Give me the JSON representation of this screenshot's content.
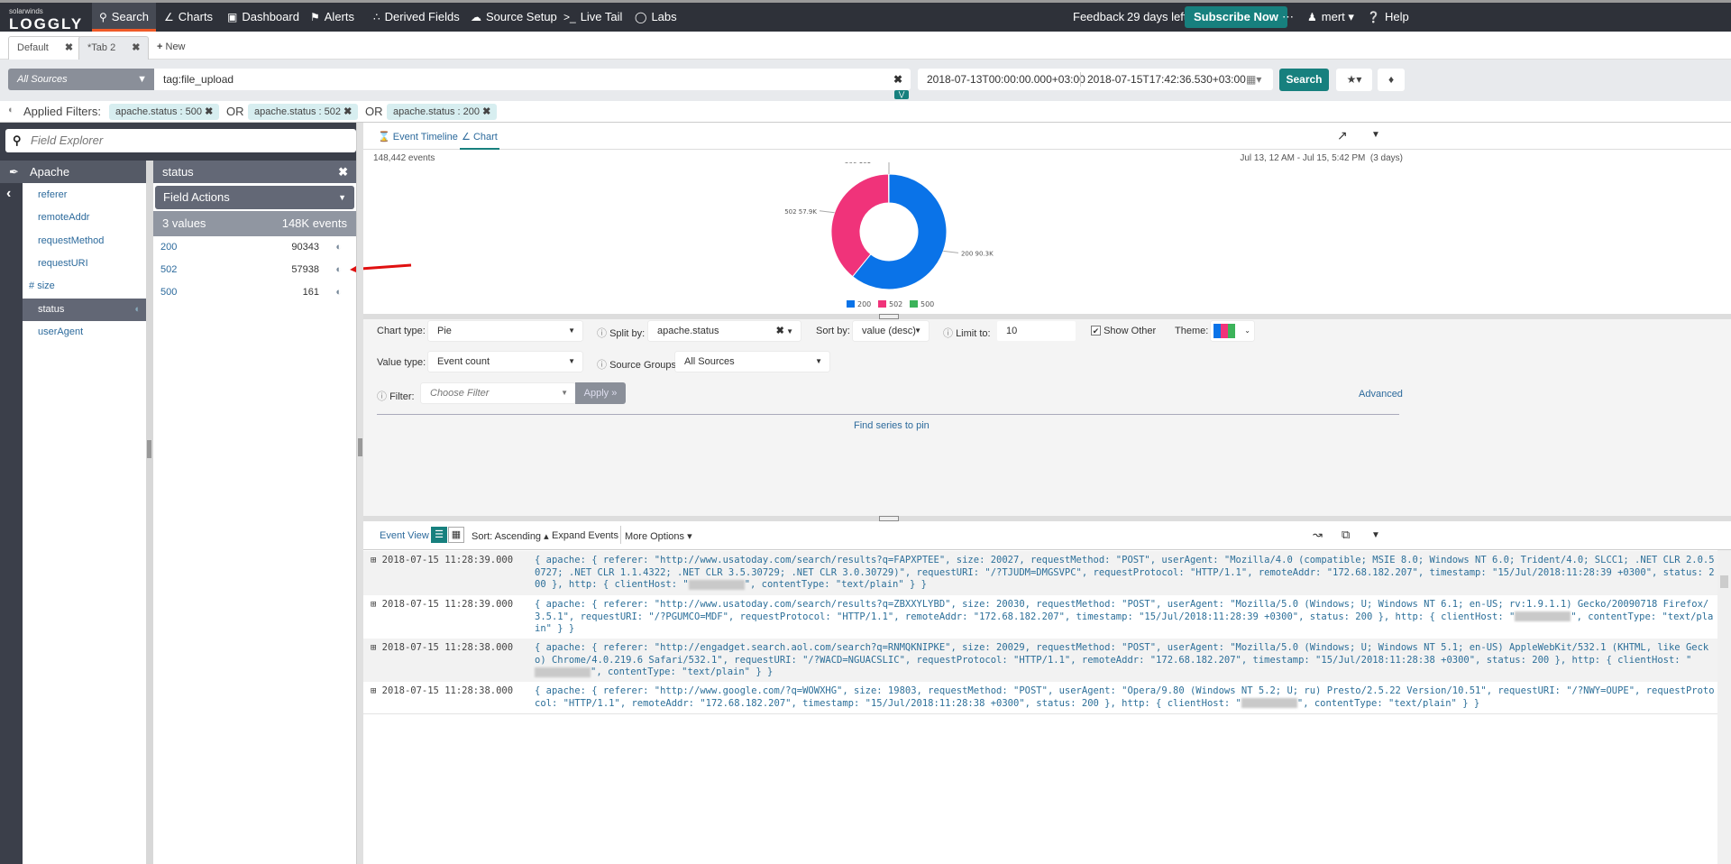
{
  "brand": {
    "company": "solarwinds",
    "product": "LOGGLY",
    "accent": "#f05a28",
    "teal": "#17807e"
  },
  "nav": {
    "items": [
      {
        "label": "Search",
        "icon": "search-icon"
      },
      {
        "label": "Charts",
        "icon": "chart-icon"
      },
      {
        "label": "Dashboard",
        "icon": "dashboard-icon"
      },
      {
        "label": "Alerts",
        "icon": "bell-icon"
      },
      {
        "label": "Derived Fields",
        "icon": "derived-fields-icon"
      },
      {
        "label": "Source Setup",
        "icon": "cloud-icon"
      },
      {
        "label": "Live Tail",
        "icon": "terminal-icon"
      },
      {
        "label": "Labs",
        "icon": "lightbulb-icon"
      }
    ],
    "feedback": "Feedback",
    "trial": "29 days left",
    "subscribe": "Subscribe Now",
    "user": "mert",
    "help": "Help"
  },
  "tabs": [
    {
      "label": "Default"
    },
    {
      "label": "*Tab 2"
    }
  ],
  "new_tab": "New",
  "search": {
    "source": "All Sources",
    "query": "tag:file_upload",
    "from": "2018-07-13T00:00:00.000+03:00",
    "to": "2018-07-15T17:42:36.530+03:00",
    "button": "Search"
  },
  "filters": {
    "label": "Applied Filters:",
    "or": "OR",
    "chips": [
      "apache.status : 500",
      "apache.status : 502",
      "apache.status : 200"
    ]
  },
  "field_explorer": {
    "placeholder": "Field Explorer",
    "group": "Apache",
    "fields": [
      "referer",
      "remoteAddr",
      "requestMethod",
      "requestURI",
      "size",
      "status",
      "userAgent"
    ],
    "size_prefix": "#",
    "field_title": "status",
    "field_actions": "Field Actions",
    "values_count": "3 values",
    "events_count": "148K events",
    "values": [
      {
        "value": "200",
        "count": "90343"
      },
      {
        "value": "502",
        "count": "57938"
      },
      {
        "value": "500",
        "count": "161"
      }
    ]
  },
  "view_tabs": {
    "timeline": "Event Timeline",
    "chart": "Chart"
  },
  "chart_info": {
    "events": "148,442 events",
    "range": "Jul 13, 12 AM - Jul 15, 5:42 PM  (3 days)"
  },
  "chart_data": {
    "type": "pie",
    "donut": true,
    "categories": [
      "200",
      "502",
      "500"
    ],
    "values": [
      90343,
      57938,
      161
    ],
    "labels": [
      "200 90.3K",
      "502 57.9K",
      "500 161"
    ],
    "colors": [
      "#0a73e8",
      "#f0337a",
      "#3cb35a"
    ],
    "legend": "bottom"
  },
  "options": {
    "chart_type_label": "Chart type:",
    "chart_type": "Pie",
    "split_label": "Split by:",
    "split": "apache.status",
    "sort_label": "Sort by:",
    "sort": "value (desc)",
    "limit_label": "Limit to:",
    "limit": "10",
    "show_other": "Show Other",
    "theme_label": "Theme:",
    "value_type_label": "Value type:",
    "value_type": "Event count",
    "source_groups_label": "Source Groups",
    "source_groups": "All Sources",
    "filter_label": "Filter:",
    "filter_placeholder": "Choose Filter",
    "apply": "Apply »",
    "advanced": "Advanced",
    "find_series": "Find series to pin"
  },
  "events_toolbar": {
    "event_view": "Event View",
    "sort": "Sort: Ascending",
    "expand": "Expand Events",
    "more": "More Options"
  },
  "events": [
    {
      "ts": "2018-07-15 11:28:39.000",
      "pre": "{ apache: { referer: \"http://www.usatoday.com/search/results?q=FAPXPTEE\", size: 20027, requestMethod: \"POST\", userAgent: \"Mozilla/4.0 (compatible; MSIE 8.0; Windows NT 6.0; Trident/4.0; SLCC1; .NET CLR 2.0.50727; .NET CLR 1.1.4322; .NET CLR 3.5.30729; .NET CLR 3.0.30729)\", requestURI: \"/?TJUDM=DMGSVPC\", requestProtocol: \"HTTP/1.1\", remoteAddr: \"172.68.182.207\", timestamp: \"15/Jul/2018:11:28:39 +0300\", status: 200 }, http: { clientHost: \"",
      "post": "\", contentType: \"text/plain\" } }"
    },
    {
      "ts": "2018-07-15 11:28:39.000",
      "pre": "{ apache: { referer: \"http://www.usatoday.com/search/results?q=ZBXXYLYBD\", size: 20030, requestMethod: \"POST\", userAgent: \"Mozilla/5.0 (Windows; U; Windows NT 6.1; en-US; rv:1.9.1.1) Gecko/20090718 Firefox/3.5.1\", requestURI: \"/?PGUMCO=MDF\", requestProtocol: \"HTTP/1.1\", remoteAddr: \"172.68.182.207\", timestamp: \"15/Jul/2018:11:28:39 +0300\", status: 200 }, http: { clientHost: \"",
      "post": "\", contentType: \"text/plain\" } }"
    },
    {
      "ts": "2018-07-15 11:28:38.000",
      "pre": "{ apache: { referer: \"http://engadget.search.aol.com/search?q=RNMQKNIPKE\", size: 20029, requestMethod: \"POST\", userAgent: \"Mozilla/5.0 (Windows; U; Windows NT 5.1; en-US) AppleWebKit/532.1 (KHTML, like Gecko) Chrome/4.0.219.6 Safari/532.1\", requestURI: \"/?WACD=NGUACSLIC\", requestProtocol: \"HTTP/1.1\", remoteAddr: \"172.68.182.207\", timestamp: \"15/Jul/2018:11:28:38 +0300\", status: 200 }, http: { clientHost: \"",
      "post": "\", contentType: \"text/plain\" } }"
    },
    {
      "ts": "2018-07-15 11:28:38.000",
      "pre": "{ apache: { referer: \"http://www.google.com/?q=WOWXHG\", size: 19803, requestMethod: \"POST\", userAgent: \"Opera/9.80 (Windows NT 5.2; U; ru) Presto/2.5.22 Version/10.51\", requestURI: \"/?NWY=OUPE\", requestProtocol: \"HTTP/1.1\", remoteAddr: \"172.68.182.207\", timestamp: \"15/Jul/2018:11:28:38 +0300\", status: 200 }, http: { clientHost: \"",
      "post": "\", contentType: \"text/plain\" } }"
    }
  ]
}
